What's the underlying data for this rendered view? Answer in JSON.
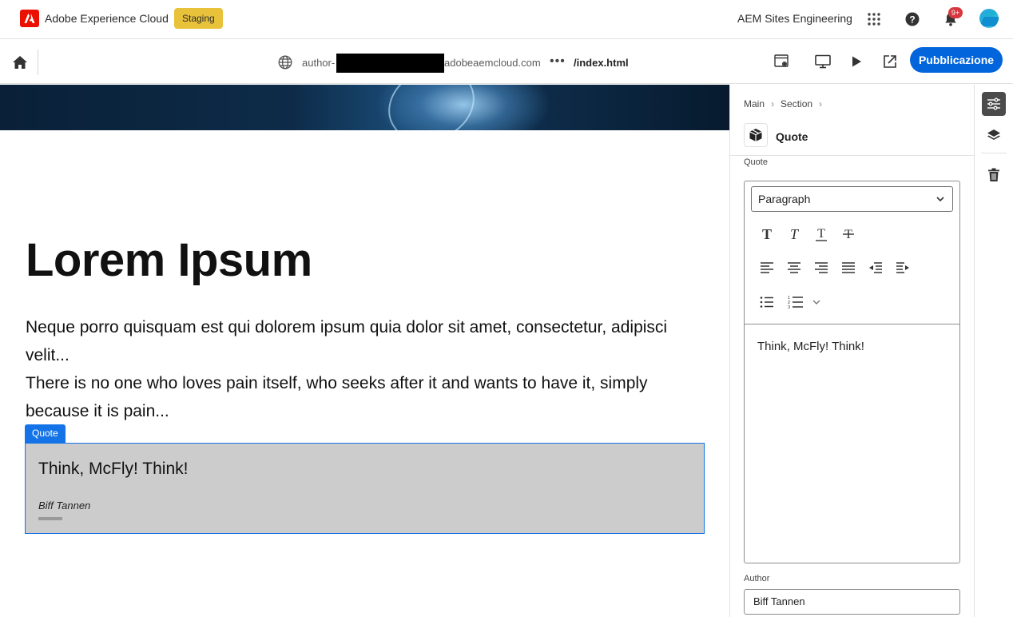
{
  "header": {
    "brand": "Adobe Experience Cloud",
    "environment_badge": "Staging",
    "org_name": "AEM Sites Engineering",
    "notification_count": "9+",
    "icons": [
      "apps-grid-icon",
      "help-icon",
      "bell-icon",
      "user-avatar"
    ]
  },
  "toolbar": {
    "url_prefix": "author-",
    "url_suffix": "adobeaemcloud.com",
    "url_more": "•••",
    "url_path": "/index.html",
    "publish_label": "Pubblicazione",
    "icons": [
      "home-icon",
      "globe-icon",
      "page-settings-icon",
      "desktop-preview-icon",
      "play-icon",
      "open-external-icon"
    ],
    "accent_color": "#0265dc"
  },
  "page": {
    "title": "Lorem Ipsum",
    "paragraph_line1": "Neque porro quisquam est qui dolorem ipsum quia dolor sit amet, consectetur, adipisci velit...",
    "paragraph_line2": "There is no one who loves pain itself, who seeks after it and wants to have it, simply because it is pain...",
    "quote_tag": "Quote",
    "quote_text": "Think, McFly! Think!",
    "quote_author": "Biff Tannen",
    "selection_color": "#1473e6"
  },
  "panel": {
    "breadcrumb": [
      "Main",
      "Section"
    ],
    "component_name": "Quote",
    "quote_field_label": "Quote",
    "format_select": "Paragraph",
    "rte_content": "Think, McFly! Think!",
    "author_field_label": "Author",
    "author_value": "Biff Tannen",
    "rte_tools": [
      "bold-icon",
      "italic-icon",
      "underline-icon",
      "strikethrough-icon",
      "align-left-icon",
      "align-center-icon",
      "align-right-icon",
      "align-justify-icon",
      "outdent-icon",
      "indent-icon",
      "bullet-list-icon",
      "numbered-list-icon",
      "list-chevron-icon"
    ]
  },
  "rail": {
    "icons": [
      "properties-icon",
      "layers-icon",
      "delete-icon"
    ]
  }
}
